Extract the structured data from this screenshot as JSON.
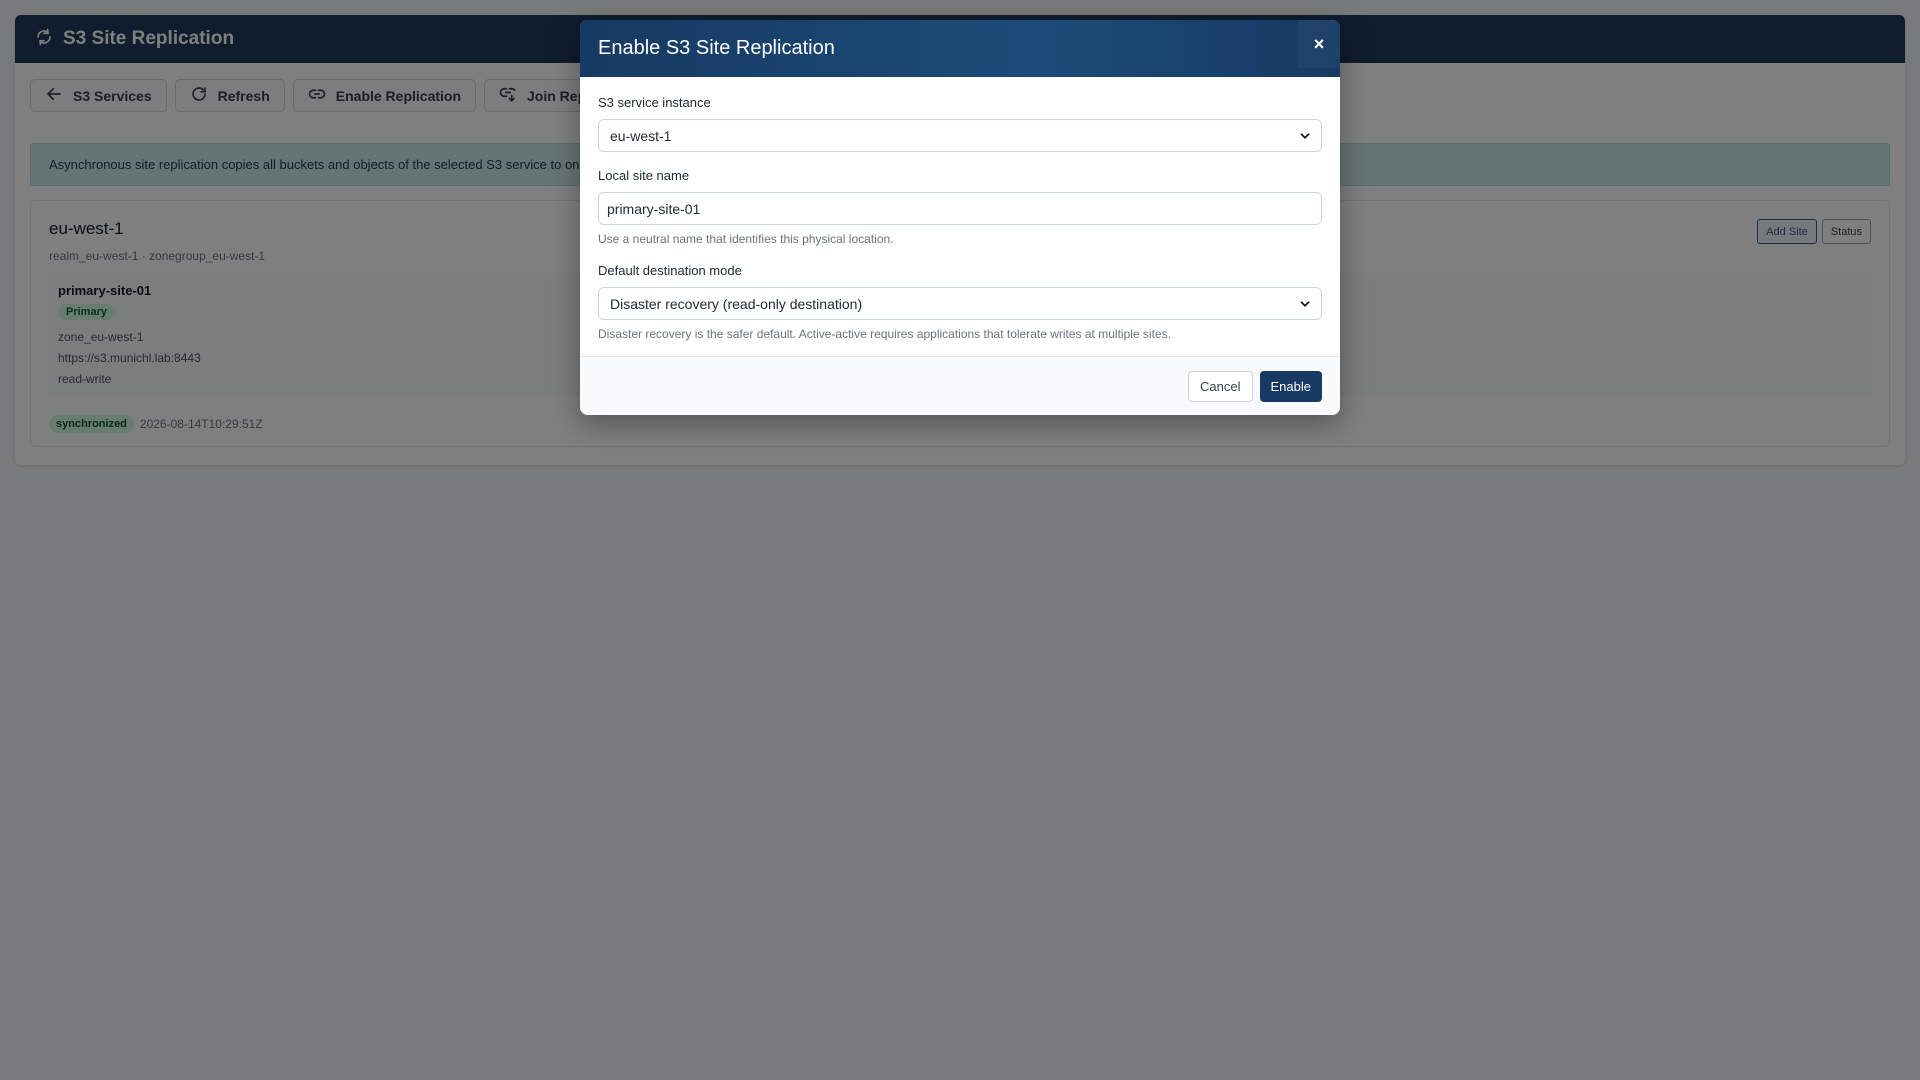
{
  "app": {
    "title": "S3 Site Replication",
    "toolbar": {
      "back_label": "S3 Services",
      "refresh_label": "Refresh",
      "enable_label": "Enable Replication",
      "join_label": "Join Replica"
    },
    "info_text": "Asynchronous site replication copies all buckets and objects of the selected S3 service to one",
    "realm_card": {
      "title": "eu-west-1",
      "subtitle": "realm_eu-west-1 · zonegroup_eu-west-1",
      "add_site_label": "Add Site",
      "status_label": "Status",
      "site": {
        "name": "primary-site-01",
        "badge": "Primary",
        "zone": "zone_eu-west-1",
        "endpoint": "https://s3.munichl.lab:8443",
        "mode": "read-write"
      },
      "sync_status": "synchronized",
      "sync_time": "2026-08-14T10:29:51Z"
    }
  },
  "modal": {
    "title": "Enable S3 Site Replication",
    "close_symbol": "×",
    "service_label": "S3 service instance",
    "service_value": "eu-west-1",
    "site_name_label": "Local site name",
    "site_name_value": "primary-site-01",
    "site_name_help": "Use a neutral name that identifies this physical location.",
    "mode_label": "Default destination mode",
    "mode_value": "Disaster recovery (read-only destination)",
    "mode_help": "Disaster recovery is the safer default. Active-active requires applications that tolerate writes at multiple sites.",
    "cancel_label": "Cancel",
    "enable_label": "Enable"
  },
  "colors": {
    "header": "#1e3a5f",
    "modal_header": "#163a63",
    "success_bg": "#d1fae5",
    "overlay": "rgba(0,0,0,0.5)"
  },
  "icons": {
    "app": "sync-icon",
    "back": "arrow-left-icon",
    "refresh": "refresh-icon",
    "enable": "link-icon",
    "join": "join-link-icon",
    "select": "chevron-down-icon"
  }
}
